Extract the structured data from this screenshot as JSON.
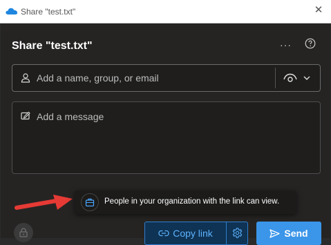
{
  "window": {
    "title": "Share \"test.txt\"",
    "close_glyph": "✕"
  },
  "dialog": {
    "heading": "Share \"test.txt\"",
    "more_glyph": "···",
    "people": {
      "placeholder": "Add a name, group, or email"
    },
    "message": {
      "placeholder": "Add a message"
    },
    "tooltip": "People in your organization with the link can view.",
    "copy_link_label": "Copy link",
    "send_label": "Send"
  },
  "icons": {
    "app": "onedrive-cloud-icon",
    "more": "more-options-icon",
    "help": "help-icon",
    "person": "person-icon",
    "eye": "eye-icon",
    "chevron": "chevron-down-icon",
    "edit": "edit-message-icon",
    "briefcase": "briefcase-icon",
    "lock": "lock-icon",
    "link": "link-icon",
    "gear": "gear-icon",
    "send": "send-icon",
    "arrow": "red-arrow-annotation"
  },
  "colors": {
    "accent": "#3b95e9",
    "link_text": "#5cb3ff",
    "arrow": "#e63a35",
    "background": "#262423"
  }
}
